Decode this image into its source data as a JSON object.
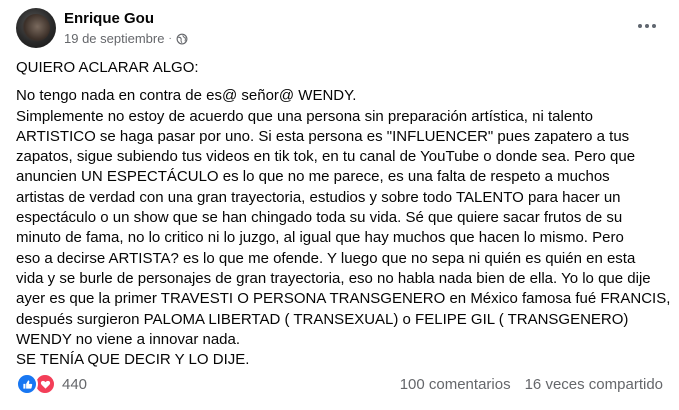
{
  "post": {
    "author": "Enrique Gou",
    "date": "19 de septiembre",
    "separator": "·",
    "heading": "QUIERO ACLARAR ALGO:",
    "lines": [
      "No tengo nada en contra de es@ señor@ WENDY.",
      "Simplemente no estoy de acuerdo que una persona sin preparación artística, ni talento",
      "ARTISTICO se haga pasar por uno. Si esta persona es \"INFLUENCER\" pues zapatero a tus",
      "zapatos, sigue subiendo tus videos en tik tok, en tu canal de YouTube o donde sea. Pero que",
      "anuncien UN ESPECTÁCULO es lo que no me parece, es una falta de respeto a muchos",
      "artistas de verdad con una gran trayectoria, estudios y sobre todo TALENTO para hacer un",
      "espectáculo o un show que se han chingado toda su vida. Sé que quiere sacar frutos de su",
      "minuto de fama, no lo critico ni lo juzgo, al igual que hay muchos que hacen lo mismo. Pero",
      "eso a decirse ARTISTA? es lo que me ofende. Y luego que no sepa ni quién es quién en esta",
      "vida y se burle de personajes de gran trayectoria, eso no habla nada bien de ella. Yo lo que dije",
      "ayer es que la primer TRAVESTI O PERSONA TRANSGENERO en México famosa fué FRANCIS,",
      "después surgieron PALOMA LIBERTAD ( TRANSEXUAL) o FELIPE GIL ( TRANSGENERO)",
      "WENDY no viene a innovar nada.",
      "SE TENÍA QUE DECIR Y LO DIJE."
    ]
  },
  "footer": {
    "reaction_count": "440",
    "comments": "100 comentarios",
    "shares": "16 veces compartido"
  },
  "colors": {
    "like": "#1877f2",
    "love": "#f33e58",
    "secondary_text": "#65676b"
  },
  "icons": [
    "globe-icon",
    "more-icon",
    "like-icon",
    "love-icon"
  ]
}
